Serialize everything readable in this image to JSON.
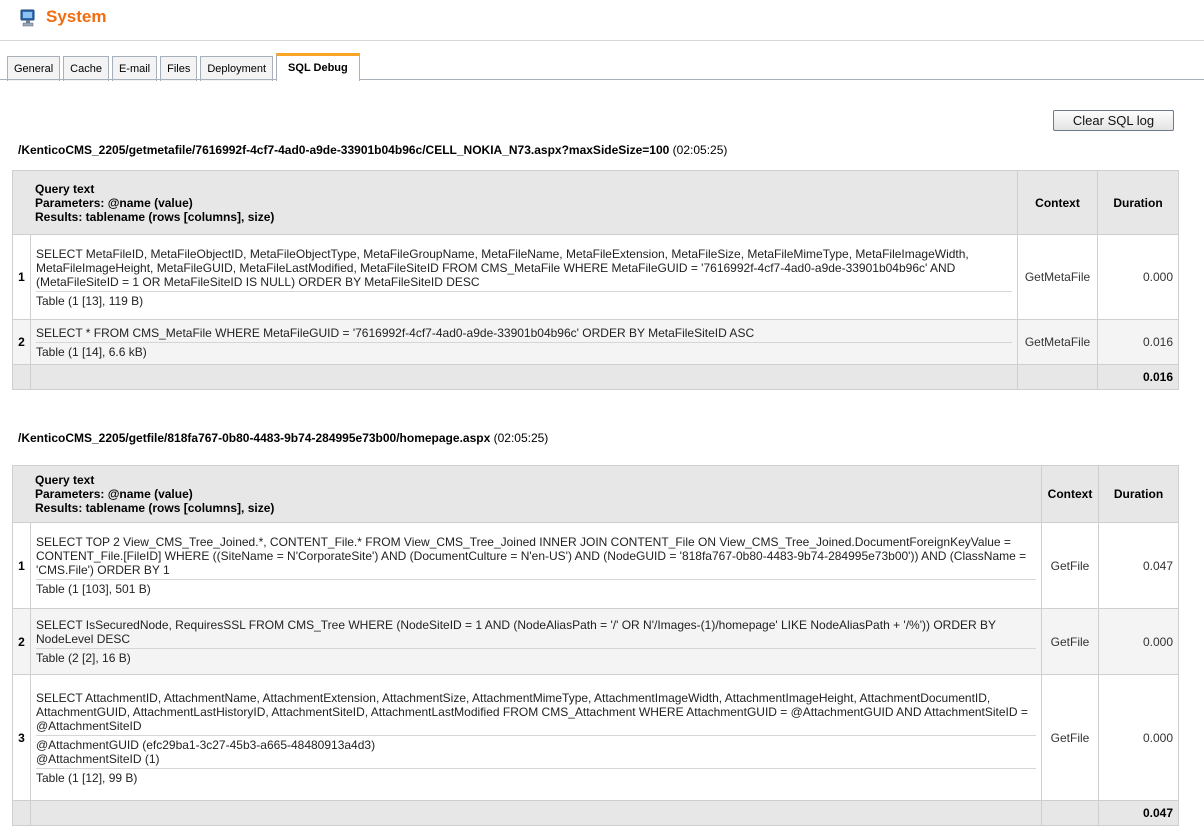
{
  "header": {
    "title": "System",
    "icon": "computer-monitor-icon"
  },
  "tabs": [
    {
      "label": "General",
      "active": false
    },
    {
      "label": "Cache",
      "active": false
    },
    {
      "label": "E-mail",
      "active": false
    },
    {
      "label": "Files",
      "active": false
    },
    {
      "label": "Deployment",
      "active": false
    },
    {
      "label": "SQL Debug",
      "active": true
    }
  ],
  "actions": {
    "clear_label": "Clear SQL log"
  },
  "table_headers": {
    "query_line1": "Query text",
    "query_line2": "Parameters: @name (value)",
    "query_line3": "Results: tablename (rows [columns], size)",
    "context": "Context",
    "duration": "Duration"
  },
  "requests": [
    {
      "url": "/KenticoCMS_2205/getmetafile/7616992f-4cf7-4ad0-a9de-33901b04b96c/CELL_NOKIA_N73.aspx?maxSideSize=100",
      "time": "(02:05:25)",
      "total": "0.016",
      "rows": [
        {
          "num": "1",
          "query": "SELECT MetaFileID, MetaFileObjectID, MetaFileObjectType, MetaFileGroupName, MetaFileName, MetaFileExtension, MetaFileSize, MetaFileMimeType, MetaFileImageWidth, MetaFileImageHeight, MetaFileGUID, MetaFileLastModified, MetaFileSiteID FROM CMS_MetaFile WHERE MetaFileGUID = '7616992f-4cf7-4ad0-a9de-33901b04b96c' AND (MetaFileSiteID = 1 OR MetaFileSiteID IS NULL) ORDER BY MetaFileSiteID DESC",
          "params": "",
          "result": "Table (1 [13], 119 B)",
          "context": "GetMetaFile",
          "duration": "0.000"
        },
        {
          "num": "2",
          "query": "SELECT * FROM CMS_MetaFile WHERE MetaFileGUID = '7616992f-4cf7-4ad0-a9de-33901b04b96c' ORDER BY MetaFileSiteID ASC",
          "params": "",
          "result": "Table (1 [14], 6.6 kB)",
          "context": "GetMetaFile",
          "duration": "0.016"
        }
      ]
    },
    {
      "url": "/KenticoCMS_2205/getfile/818fa767-0b80-4483-9b74-284995e73b00/homepage.aspx",
      "time": "(02:05:25)",
      "total": "0.047",
      "rows": [
        {
          "num": "1",
          "query": "SELECT TOP 2 View_CMS_Tree_Joined.*, CONTENT_File.* FROM View_CMS_Tree_Joined INNER JOIN CONTENT_File ON View_CMS_Tree_Joined.DocumentForeignKeyValue = CONTENT_File.[FileID] WHERE ((SiteName = N'CorporateSite') AND (DocumentCulture = N'en-US') AND (NodeGUID = '818fa767-0b80-4483-9b74-284995e73b00')) AND (ClassName = 'CMS.File') ORDER BY 1",
          "params": "",
          "result": "Table (1 [103], 501 B)",
          "context": "GetFile",
          "duration": "0.047"
        },
        {
          "num": "2",
          "query": "SELECT IsSecuredNode, RequiresSSL FROM CMS_Tree WHERE (NodeSiteID = 1 AND (NodeAliasPath = '/' OR N'/Images-(1)/homepage' LIKE NodeAliasPath + '/%')) ORDER BY NodeLevel DESC",
          "params": "",
          "result": "Table (2 [2], 16 B)",
          "context": "GetFile",
          "duration": "0.000"
        },
        {
          "num": "3",
          "query": "SELECT AttachmentID, AttachmentName, AttachmentExtension, AttachmentSize, AttachmentMimeType, AttachmentImageWidth, AttachmentImageHeight, AttachmentDocumentID, AttachmentGUID, AttachmentLastHistoryID, AttachmentSiteID, AttachmentLastModified FROM CMS_Attachment WHERE AttachmentGUID = @AttachmentGUID AND AttachmentSiteID = @AttachmentSiteID",
          "params_line1": "@AttachmentGUID (efc29ba1-3c27-45b3-a665-48480913a4d3)",
          "params_line2": "@AttachmentSiteID (1)",
          "result": "Table (1 [12], 99 B)",
          "context": "GetFile",
          "duration": "0.000"
        }
      ]
    }
  ]
}
